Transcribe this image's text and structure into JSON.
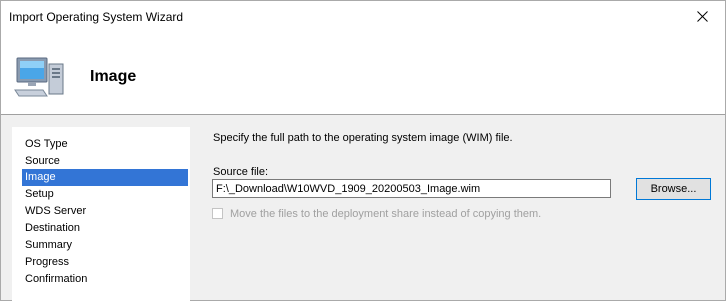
{
  "window": {
    "title": "Import Operating System Wizard",
    "close_glyph": "✕"
  },
  "header": {
    "title": "Image",
    "icon": "computer-icon"
  },
  "nav": {
    "items": [
      {
        "label": "OS Type",
        "selected": false
      },
      {
        "label": "Source",
        "selected": false
      },
      {
        "label": "Image",
        "selected": true
      },
      {
        "label": "Setup",
        "selected": false
      },
      {
        "label": "WDS Server",
        "selected": false
      },
      {
        "label": "Destination",
        "selected": false
      },
      {
        "label": "Summary",
        "selected": false
      },
      {
        "label": "Progress",
        "selected": false
      },
      {
        "label": "Confirmation",
        "selected": false
      }
    ]
  },
  "main": {
    "description": "Specify the full path to the operating system image (WIM) file.",
    "source_label": "Source file:",
    "source_value": "F:\\_Download\\W10WVD_1909_20200503_Image.wim",
    "browse_label": "Browse...",
    "move_label": "Move the files to the deployment share instead of copying them.",
    "move_checked": false,
    "move_enabled": false
  },
  "colors": {
    "selection": "#3375d6",
    "disabled_text": "#a0a0a0",
    "button_border": "#0078d7"
  }
}
